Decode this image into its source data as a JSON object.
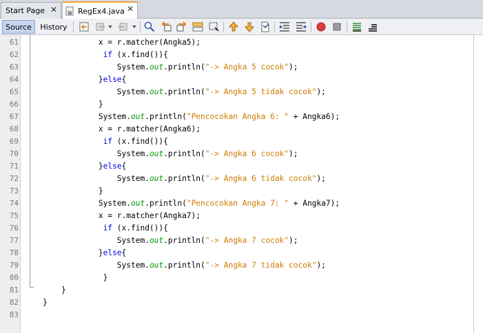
{
  "tabs": [
    {
      "label": "Start Page",
      "close": "✕"
    },
    {
      "label": "RegEx4.java",
      "close": "✕"
    }
  ],
  "toolbar": {
    "source_label": "Source",
    "history_label": "History"
  },
  "editor": {
    "lines": [
      {
        "num": "61",
        "indent": "            ",
        "parts": [
          {
            "t": "x = r.matcher(Angka5);",
            "c": ""
          }
        ]
      },
      {
        "num": "62",
        "indent": "             ",
        "parts": [
          {
            "t": "if",
            "c": "kw"
          },
          {
            "t": " (x.find()){",
            "c": ""
          }
        ]
      },
      {
        "num": "63",
        "indent": "                ",
        "parts": [
          {
            "t": "System.",
            "c": ""
          },
          {
            "t": "out",
            "c": "fld"
          },
          {
            "t": ".println(",
            "c": ""
          },
          {
            "t": "\"-> Angka 5 cocok\"",
            "c": "str"
          },
          {
            "t": ");",
            "c": ""
          }
        ]
      },
      {
        "num": "64",
        "indent": "            ",
        "parts": [
          {
            "t": "}",
            "c": ""
          },
          {
            "t": "else",
            "c": "kw"
          },
          {
            "t": "{",
            "c": ""
          }
        ]
      },
      {
        "num": "65",
        "indent": "                ",
        "parts": [
          {
            "t": "System.",
            "c": ""
          },
          {
            "t": "out",
            "c": "fld"
          },
          {
            "t": ".println(",
            "c": ""
          },
          {
            "t": "\"-> Angka 5 tidak cocok\"",
            "c": "str"
          },
          {
            "t": ");",
            "c": ""
          }
        ]
      },
      {
        "num": "66",
        "indent": "            ",
        "parts": [
          {
            "t": "}",
            "c": ""
          }
        ]
      },
      {
        "num": "67",
        "indent": "            ",
        "parts": [
          {
            "t": "System.",
            "c": ""
          },
          {
            "t": "out",
            "c": "fld"
          },
          {
            "t": ".println(",
            "c": ""
          },
          {
            "t": "\"Pencocokan Angka 6: \"",
            "c": "str"
          },
          {
            "t": " + Angka6);",
            "c": ""
          }
        ]
      },
      {
        "num": "68",
        "indent": "            ",
        "parts": [
          {
            "t": "x = r.matcher(Angka6);",
            "c": ""
          }
        ]
      },
      {
        "num": "69",
        "indent": "             ",
        "parts": [
          {
            "t": "if",
            "c": "kw"
          },
          {
            "t": " (x.find()){",
            "c": ""
          }
        ]
      },
      {
        "num": "70",
        "indent": "                ",
        "parts": [
          {
            "t": "System.",
            "c": ""
          },
          {
            "t": "out",
            "c": "fld"
          },
          {
            "t": ".println(",
            "c": ""
          },
          {
            "t": "\"-> Angka 6 cocok\"",
            "c": "str"
          },
          {
            "t": ");",
            "c": ""
          }
        ]
      },
      {
        "num": "71",
        "indent": "            ",
        "parts": [
          {
            "t": "}",
            "c": ""
          },
          {
            "t": "else",
            "c": "kw"
          },
          {
            "t": "{",
            "c": ""
          }
        ]
      },
      {
        "num": "72",
        "indent": "                ",
        "parts": [
          {
            "t": "System.",
            "c": ""
          },
          {
            "t": "out",
            "c": "fld"
          },
          {
            "t": ".println(",
            "c": ""
          },
          {
            "t": "\"-> Angka 6 tidak cocok\"",
            "c": "str"
          },
          {
            "t": ");",
            "c": ""
          }
        ]
      },
      {
        "num": "73",
        "indent": "            ",
        "parts": [
          {
            "t": "}",
            "c": ""
          }
        ]
      },
      {
        "num": "74",
        "indent": "            ",
        "parts": [
          {
            "t": "System.",
            "c": ""
          },
          {
            "t": "out",
            "c": "fld"
          },
          {
            "t": ".println(",
            "c": ""
          },
          {
            "t": "\"Pencocokan Angka 7: \"",
            "c": "str"
          },
          {
            "t": " + Angka7);",
            "c": ""
          }
        ]
      },
      {
        "num": "75",
        "indent": "            ",
        "parts": [
          {
            "t": "x = r.matcher(Angka7);",
            "c": ""
          }
        ]
      },
      {
        "num": "76",
        "indent": "             ",
        "parts": [
          {
            "t": "if",
            "c": "kw"
          },
          {
            "t": " (x.find()){",
            "c": ""
          }
        ]
      },
      {
        "num": "77",
        "indent": "                ",
        "parts": [
          {
            "t": "System.",
            "c": ""
          },
          {
            "t": "out",
            "c": "fld"
          },
          {
            "t": ".println(",
            "c": ""
          },
          {
            "t": "\"-> Angka 7 cocok\"",
            "c": "str"
          },
          {
            "t": ");",
            "c": ""
          }
        ]
      },
      {
        "num": "78",
        "indent": "            ",
        "parts": [
          {
            "t": "}",
            "c": ""
          },
          {
            "t": "else",
            "c": "kw"
          },
          {
            "t": "{",
            "c": ""
          }
        ]
      },
      {
        "num": "79",
        "indent": "                ",
        "parts": [
          {
            "t": "System.",
            "c": ""
          },
          {
            "t": "out",
            "c": "fld"
          },
          {
            "t": ".println(",
            "c": ""
          },
          {
            "t": "\"-> Angka 7 tidak cocok\"",
            "c": "str"
          },
          {
            "t": ");",
            "c": ""
          }
        ]
      },
      {
        "num": "80",
        "indent": "             ",
        "parts": [
          {
            "t": "}",
            "c": ""
          }
        ]
      },
      {
        "num": "81",
        "indent": "    ",
        "parts": [
          {
            "t": "}",
            "c": ""
          }
        ]
      },
      {
        "num": "82",
        "indent": "",
        "parts": [
          {
            "t": "}",
            "c": ""
          }
        ]
      },
      {
        "num": "83",
        "indent": "",
        "parts": []
      }
    ]
  },
  "colors": {
    "string": "#ce7b00",
    "keyword": "#0000e6",
    "static_field": "#009900",
    "active_tab_accent": "#f0a43a"
  }
}
